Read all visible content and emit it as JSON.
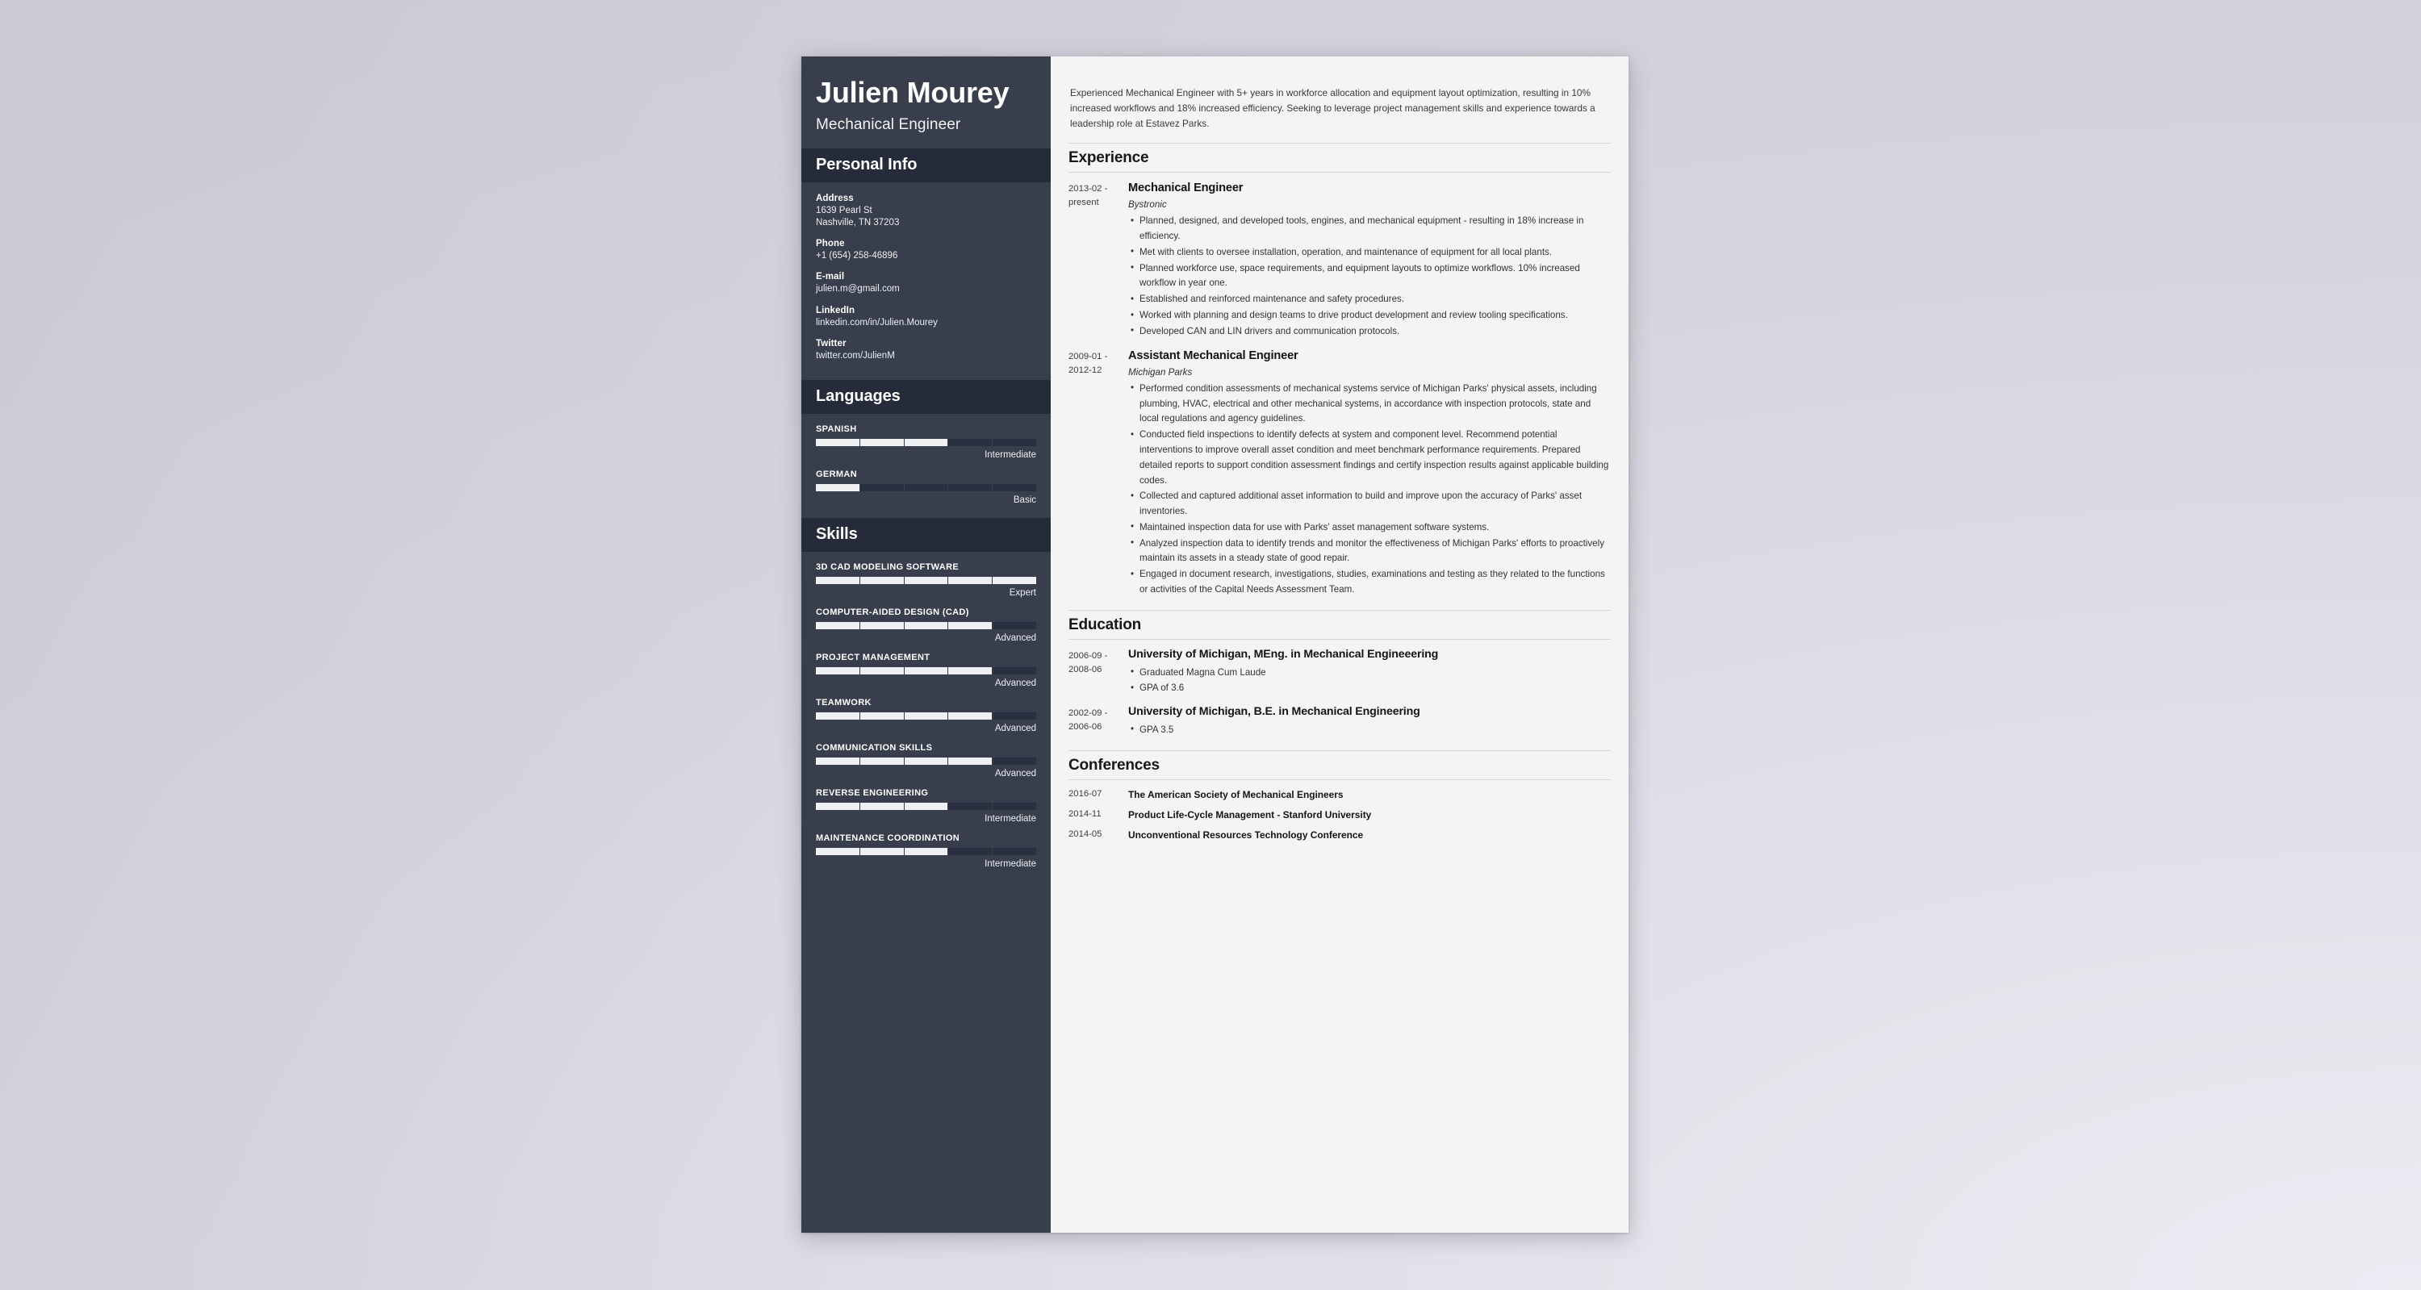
{
  "document": {
    "type": "resume"
  },
  "sidebar": {
    "name": "Julien Mourey",
    "job_title": "Mechanical Engineer",
    "personal_info": {
      "heading": "Personal Info",
      "items": [
        {
          "label": "Address",
          "value": "1639 Pearl St\nNashville, TN 37203"
        },
        {
          "label": "Phone",
          "value": "+1 (654) 258-46896"
        },
        {
          "label": "E-mail",
          "value": "julien.m@gmail.com"
        },
        {
          "label": "LinkedIn",
          "value": "linkedin.com/in/Julien.Mourey"
        },
        {
          "label": "Twitter",
          "value": "twitter.com/JulienM"
        }
      ]
    },
    "languages": {
      "heading": "Languages",
      "items": [
        {
          "name": "SPANISH",
          "level": "Intermediate",
          "filled": 3,
          "total": 5
        },
        {
          "name": "GERMAN",
          "level": "Basic",
          "filled": 1,
          "total": 5
        }
      ]
    },
    "skills": {
      "heading": "Skills",
      "items": [
        {
          "name": "3D CAD MODELING SOFTWARE",
          "level": "Expert",
          "filled": 5,
          "total": 5
        },
        {
          "name": "COMPUTER-AIDED DESIGN (CAD)",
          "level": "Advanced",
          "filled": 4,
          "total": 5
        },
        {
          "name": "PROJECT MANAGEMENT",
          "level": "Advanced",
          "filled": 4,
          "total": 5
        },
        {
          "name": "TEAMWORK",
          "level": "Advanced",
          "filled": 4,
          "total": 5
        },
        {
          "name": "COMMUNICATION SKILLS",
          "level": "Advanced",
          "filled": 4,
          "total": 5
        },
        {
          "name": "REVERSE ENGINEERING",
          "level": "Intermediate",
          "filled": 3,
          "total": 5
        },
        {
          "name": "MAINTENANCE COORDINATION",
          "level": "Intermediate",
          "filled": 3,
          "total": 5
        }
      ]
    }
  },
  "main": {
    "summary": "Experienced Mechanical Engineer with 5+ years in workforce allocation and equipment layout optimization, resulting in 10% increased workflows and 18% increased efficiency. Seeking to leverage project management skills and experience towards a leadership role at Estavez Parks.",
    "experience": {
      "heading": "Experience",
      "entries": [
        {
          "date": "2013-02 - present",
          "title": "Mechanical Engineer",
          "org": "Bystronic",
          "bullets": [
            "Planned, designed, and developed tools, engines, and mechanical equipment - resulting in 18% increase in efficiency.",
            "Met with clients to oversee installation, operation, and maintenance of equipment for all local plants.",
            "Planned workforce use, space requirements, and equipment layouts to optimize workflows. 10% increased workflow in year one.",
            "Established and reinforced maintenance and safety procedures.",
            "Worked with planning and design teams to drive product development and review tooling specifications.",
            "Developed CAN and LIN drivers and communication protocols."
          ]
        },
        {
          "date": "2009-01 - 2012-12",
          "title": "Assistant Mechanical Engineer",
          "org": "Michigan Parks",
          "bullets": [
            "Performed condition assessments of mechanical systems service of Michigan Parks' physical assets, including plumbing, HVAC, electrical and other mechanical systems, in accordance with inspection protocols, state and local regulations and agency guidelines.",
            "Conducted field inspections to identify defects at system and component level. Recommend potential interventions to improve overall asset condition and meet benchmark performance requirements. Prepared detailed reports to support condition assessment findings and certify inspection results against applicable building codes.",
            "Collected and captured additional asset information to build and improve upon the accuracy of Parks' asset inventories.",
            "Maintained inspection data for use with Parks' asset management software systems.",
            "Analyzed inspection data to identify trends and monitor the effectiveness of Michigan Parks' efforts to proactively maintain its assets in a steady state of good repair.",
            "Engaged in document research, investigations, studies, examinations and testing as they related to the functions or activities of the Capital Needs Assessment Team."
          ]
        }
      ]
    },
    "education": {
      "heading": "Education",
      "entries": [
        {
          "date": "2006-09 - 2008-06",
          "title": "University of Michigan, MEng. in Mechanical Engineeering",
          "bullets": [
            "Graduated Magna Cum Laude",
            "GPA of 3.6"
          ]
        },
        {
          "date": "2002-09 - 2006-06",
          "title": "University of Michigan, B.E. in Mechanical Engineering",
          "bullets": [
            "GPA 3.5"
          ]
        }
      ]
    },
    "conferences": {
      "heading": "Conferences",
      "entries": [
        {
          "date": "2016-07",
          "name": "The American Society of Mechanical Engineers"
        },
        {
          "date": "2014-11",
          "name": "Product Life-Cycle Management - Stanford University"
        },
        {
          "date": "2014-05",
          "name": "Unconventional Resources Technology Conference"
        }
      ]
    }
  },
  "colors": {
    "sidebar_bg": "#383e4b",
    "sidebar_header_bg": "#252b38",
    "meter_fill": "#eef0f1",
    "meter_track": "#2a3040",
    "paper_bg": "#f4f4f4",
    "page_bg": "#d6d4dc"
  }
}
